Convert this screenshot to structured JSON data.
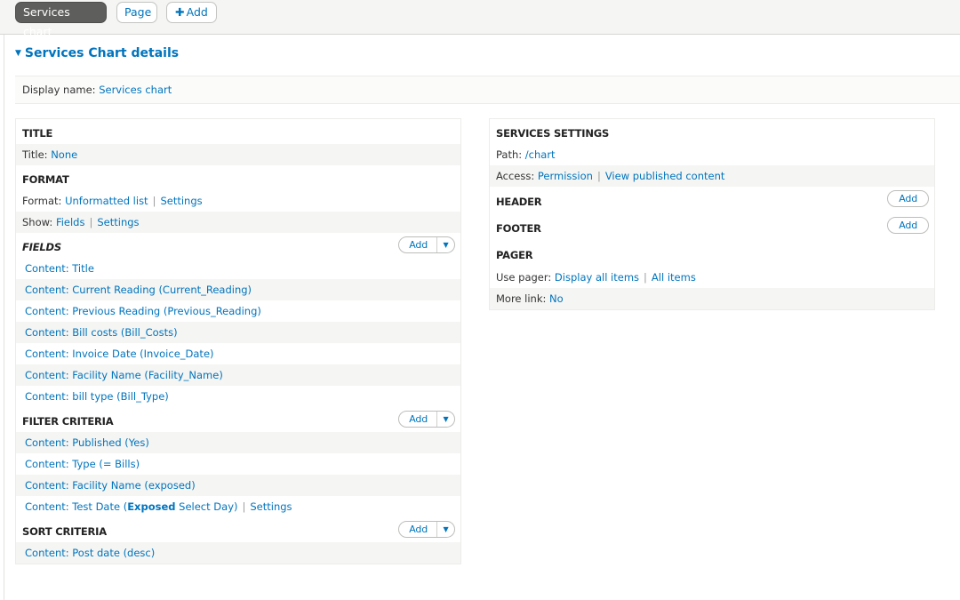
{
  "tabs": {
    "active": "Services chart",
    "page": "Page",
    "add": "Add"
  },
  "details": {
    "toggle_label": "Services Chart details",
    "display_name_label": "Display name:",
    "display_name_value": "Services chart"
  },
  "left": {
    "title": {
      "heading": "TITLE",
      "label": "Title:",
      "value": "None"
    },
    "format": {
      "heading": "FORMAT",
      "format_label": "Format:",
      "format_value": "Unformatted list",
      "format_settings": "Settings",
      "show_label": "Show:",
      "show_value": "Fields",
      "show_settings": "Settings"
    },
    "fields": {
      "heading": "FIELDS",
      "add_label": "Add",
      "items": [
        "Content: Title",
        "Content: Current Reading (Current_Reading)",
        "Content: Previous Reading (Previous_Reading)",
        "Content: Bill costs (Bill_Costs)",
        "Content: Invoice Date (Invoice_Date)",
        "Content: Facility Name (Facility_Name)",
        "Content: bill type (Bill_Type)"
      ]
    },
    "filter": {
      "heading": "FILTER CRITERIA",
      "add_label": "Add",
      "items": [
        "Content: Published (Yes)",
        "Content: Type (= Bills)",
        "Content: Facility Name (exposed)"
      ],
      "last_prefix": "Content: Test Date (",
      "last_bold": "Exposed",
      "last_suffix": " Select Day)",
      "last_settings": "Settings"
    },
    "sort": {
      "heading": "SORT CRITERIA",
      "add_label": "Add",
      "items": [
        "Content: Post date (desc)"
      ]
    }
  },
  "right": {
    "settings": {
      "heading": "SERVICES SETTINGS",
      "path_label": "Path:",
      "path_value": "/chart",
      "access_label": "Access:",
      "access_value": "Permission",
      "access_extra": "View published content"
    },
    "header": {
      "heading": "HEADER",
      "add_label": "Add"
    },
    "footer": {
      "heading": "FOOTER",
      "add_label": "Add"
    },
    "pager": {
      "heading": "PAGER",
      "use_label": "Use pager:",
      "use_value": "Display all items",
      "use_extra": "All items",
      "more_label": "More link:",
      "more_value": "No"
    }
  }
}
